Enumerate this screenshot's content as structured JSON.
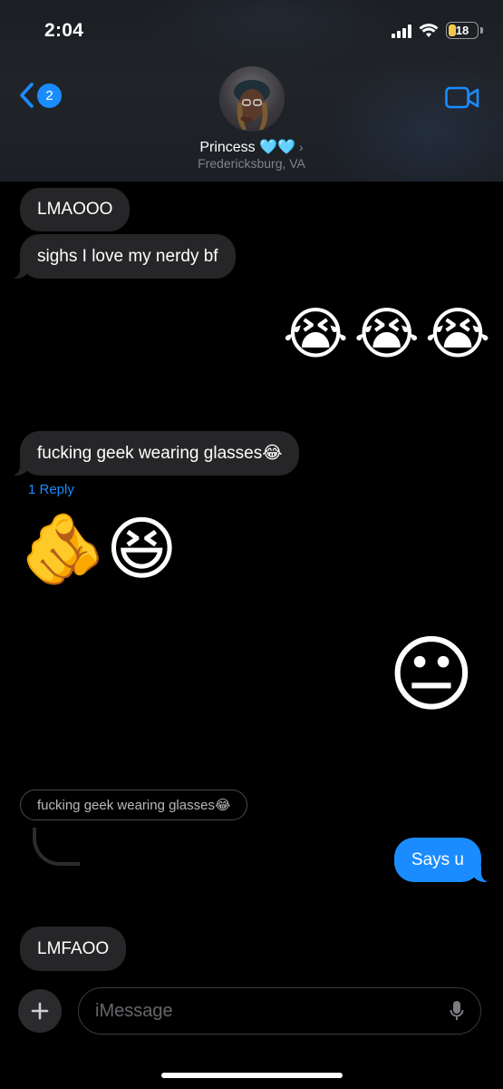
{
  "status_bar": {
    "time": "2:04",
    "battery": "18"
  },
  "header": {
    "back_count": "2",
    "contact_name": "Princess",
    "contact_hearts": "🩵🩵",
    "contact_location": "Fredericksburg, VA"
  },
  "messages": [
    {
      "direction": "in",
      "text": "LMAOOO"
    },
    {
      "direction": "in",
      "text": "sighs I love my nerdy bf"
    },
    {
      "direction": "out",
      "text": "😭😭😭"
    },
    {
      "direction": "in",
      "text": "fucking geek wearing glasses😂",
      "reply_count_label": "1 Reply"
    },
    {
      "direction": "in",
      "text": "🫵😆"
    },
    {
      "direction": "out",
      "text": "😐"
    },
    {
      "direction": "in",
      "quoted": "fucking geek wearing glasses😂"
    },
    {
      "direction": "out",
      "text": "Says u"
    },
    {
      "direction": "in",
      "text": "LMFAOO"
    }
  ],
  "composer": {
    "placeholder": "iMessage"
  },
  "colors": {
    "accent": "#1a8cff",
    "bubble_in": "#262628",
    "background": "#000000"
  }
}
